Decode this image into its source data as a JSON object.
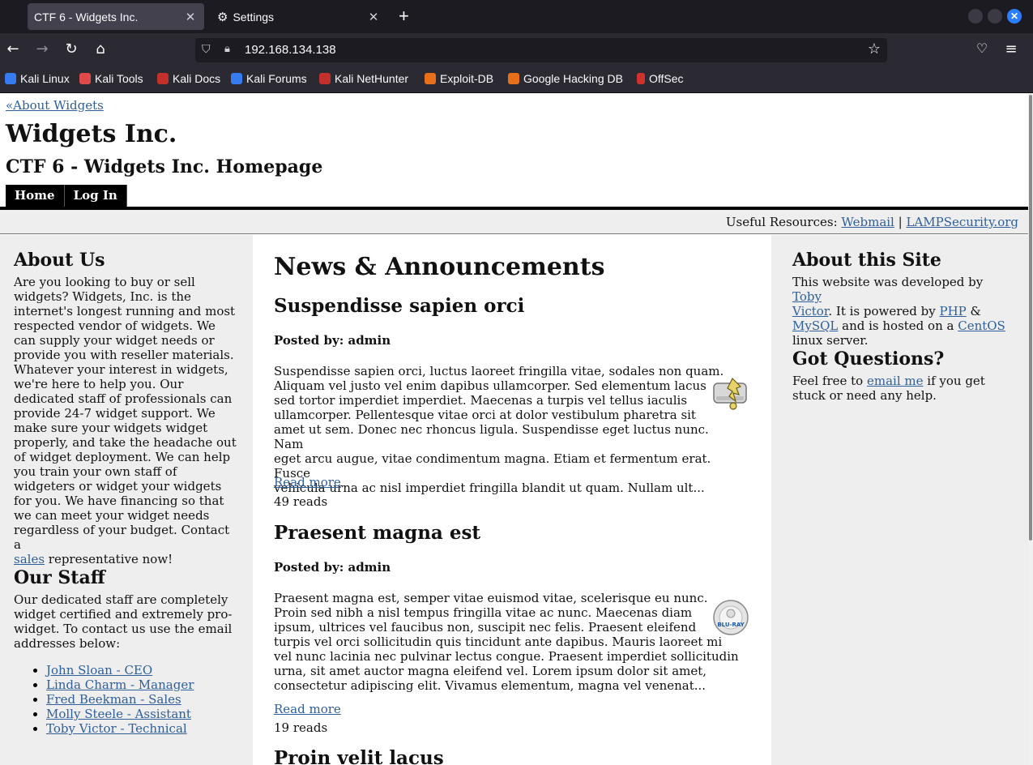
{
  "browser": {
    "tabs": [
      {
        "title": "CTF 6 - Widgets Inc.",
        "active": true
      },
      {
        "title": "Settings",
        "active": false
      }
    ],
    "url": "192.168.134.138",
    "bookmarks": [
      {
        "label": "Kali Linux",
        "color": "#367bf0"
      },
      {
        "label": "Kali Tools",
        "color": "#e04a4a"
      },
      {
        "label": "Kali Docs",
        "color": "#c4302b"
      },
      {
        "label": "Kali Forums",
        "color": "#367bf0"
      },
      {
        "label": "Kali NetHunter",
        "color": "#c4302b"
      },
      {
        "label": "Exploit-DB",
        "color": "#e8701a"
      },
      {
        "label": "Google Hacking DB",
        "color": "#e8701a"
      },
      {
        "label": "OffSec",
        "color": "#d0312d"
      }
    ]
  },
  "page": {
    "back_link": "«About Widgets",
    "site_title": "Widgets Inc.",
    "subtitle": "CTF 6 - Widgets Inc. Homepage",
    "menu": [
      "Home",
      "Log In"
    ],
    "resources": {
      "label": "Useful Resources:",
      "link1": "Webmail",
      "sep": "|",
      "link2": "LAMPSecurity.org"
    }
  },
  "left": {
    "about_title": "About Us",
    "about_text_lines": [
      "Are you looking to buy or sell",
      "widgets? Widgets, Inc. is the",
      "internet's longest running and most",
      "respected vendor of widgets. We",
      "can supply your widget needs or",
      "provide you with reseller materials.",
      "Whatever your interest in widgets,",
      "we're here to help you. Our",
      "dedicated staff of professionals can",
      "provide 24-7 widget support. We",
      "make sure your widgets widget",
      "properly, and take the headache out",
      "of widget deployment. We can help",
      "you train your own staff of",
      "widgeters or widget your widgets",
      "for you. We have financing so that",
      "we can meet your widget needs",
      "regardless of your budget. Contact a"
    ],
    "about_link": "sales",
    "about_tail": " representative now!",
    "staff_title": "Our Staff",
    "staff_text_lines": [
      "Our dedicated staff are completely",
      "widget certified and extremely pro-",
      "widget. To contact us use the email",
      "addresses below:"
    ],
    "staff": [
      "John Sloan - CEO",
      "Linda Charm - Manager",
      "Fred Beekman - Sales",
      "Molly Steele - Assistant",
      "Toby Victor - Technical"
    ]
  },
  "center": {
    "heading": "News & Announcements",
    "posts": [
      {
        "title": "Suspendisse sapien orci",
        "posted": "Posted by: admin",
        "lines": [
          "Suspendisse sapien orci, luctus laoreet fringilla vitae, sodales non quam.",
          "Aliquam vel justo vel enim dapibus ullamcorper. Sed elementum lacus",
          "sed tortor imperdiet imperdiet. Maecenas a turpis vel tellus iaculis",
          "ullamcorper. Pellentesque vitae orci at dolor vestibulum pharetra sit",
          "amet ut sem. Donec nec rhoncus ligula. Suspendisse eget luctus nunc. Nam",
          "eget arcu augue, vitae condimentum magna. Etiam et fermentum erat. Fusce",
          "vehicula urna ac nisl imperdiet fringilla blandit ut quam. Nullam ult..."
        ],
        "read_more": "Read more",
        "reads": "49 reads",
        "icon": "archive-drive-icon"
      },
      {
        "title": "Praesent magna est",
        "posted": "Posted by: admin",
        "lines": [
          "Praesent magna est, semper vitae euismod vitae, scelerisque eu nunc.",
          "Proin sed nibh a nisl tempus fringilla vitae ac nunc. Maecenas diam",
          "ipsum, ultrices vel faucibus non, suscipit nec felis. Praesent eleifend",
          "turpis vel orci sollicitudin quis tincidunt ante dapibus. Mauris laoreet mi",
          "vel nunc lacinia nec pulvinar lectus congue. Praesent imperdiet sollicitudin",
          "urna, sit amet auctor magna eleifend vel. Lorem ipsum dolor sit amet,",
          "consectetur adipiscing elit. Vivamus elementum, magna vel venenat..."
        ],
        "read_more": "Read more",
        "reads": "19 reads",
        "icon": "blu-ray-disc-icon",
        "disc_label": "BLU-RAY"
      },
      {
        "title": "Proin velit lacus"
      }
    ]
  },
  "right": {
    "about_title": "About this Site",
    "about_line1_a": "This website was developed by ",
    "about_link1": "Toby",
    "about_link1b": "Victor",
    "about_line2_b": ". It is powered by ",
    "about_link2": "PHP",
    "about_line2_c": " &",
    "about_link3": "MySQL",
    "about_line3_b": " and is hosted on a ",
    "about_link4": "CentOS",
    "about_line4": "linux server.",
    "questions_title": "Got Questions?",
    "q_line1_a": "Feel free to ",
    "q_link": "email me",
    "q_line1_b": " if you get",
    "q_line2": "stuck or need any help."
  }
}
